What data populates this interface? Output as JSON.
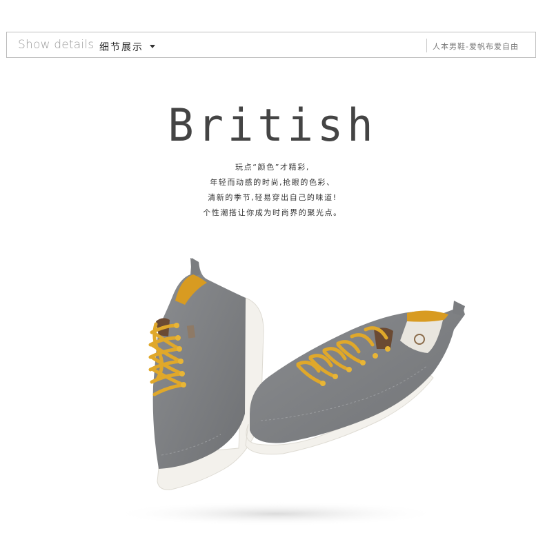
{
  "header": {
    "show_label": "Show details",
    "section_label": "细节展示",
    "tagline": "人本男鞋-爱帆布爱自由"
  },
  "hero": {
    "title": "British",
    "lines": [
      "玩点“颜色”才精彩,",
      "年轻而动感的时尚,抢眼的色彩、",
      "清新的季节,轻易穿出自己的味道!",
      "个性潮搭让你成为时尚界的聚光点。"
    ]
  },
  "colors": {
    "canvas": "#7d7f82",
    "lace": "#e0a82a",
    "sole": "#f3f1ec",
    "lining": "#d79a22"
  }
}
